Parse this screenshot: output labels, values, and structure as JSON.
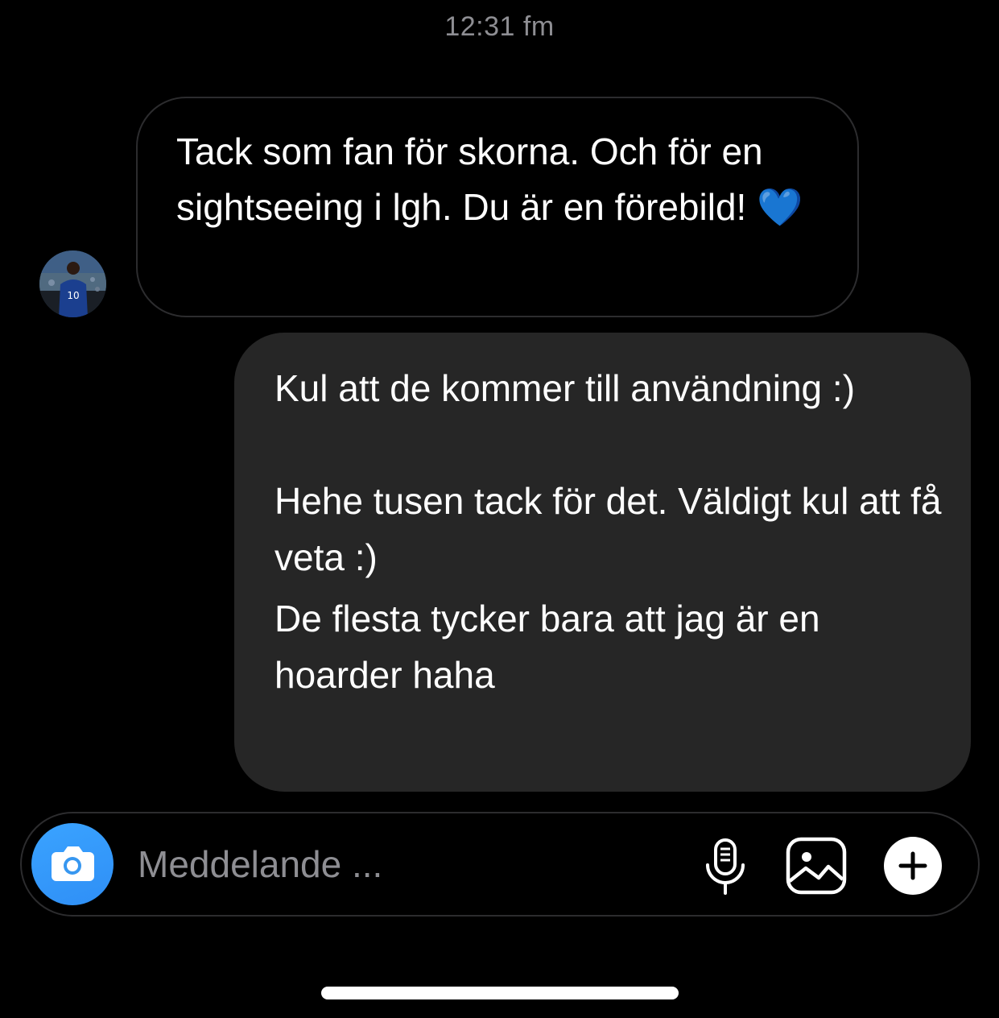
{
  "timestamp": "12:31 fm",
  "incoming": {
    "avatar_icon": "avatar-soccer-fan",
    "text_main": "Tack som fan för skorna. Och för en sightseeing i lgh. Du är en förebild!",
    "emoji": "💙"
  },
  "outgoing": {
    "paragraph1": "Kul att de kommer till användning :)",
    "paragraph2": "Hehe tusen tack för det. Väldigt kul att få veta :)",
    "paragraph3": "De flesta tycker bara att jag är en hoarder haha"
  },
  "composer": {
    "placeholder": "Meddelande ...",
    "value": "",
    "camera_icon": "camera-icon",
    "mic_icon": "microphone-icon",
    "gallery_icon": "gallery-icon",
    "plus_icon": "plus-icon",
    "accent_color": "#3797f0"
  },
  "colors": {
    "background": "#000000",
    "outgoing_bubble": "#262626",
    "incoming_border": "#2c2c2e",
    "muted_text": "#8e8e93",
    "heart": "#1e78ff"
  }
}
